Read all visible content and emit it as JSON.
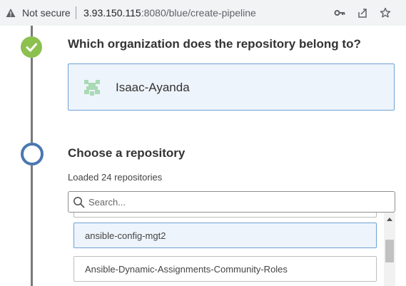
{
  "browser": {
    "security_label": "Not secure",
    "url_host": "3.93.150.115",
    "url_rest": ":8080/blue/create-pipeline"
  },
  "steps": {
    "organization": {
      "heading": "Which organization does the repository belong to?",
      "selected_org": "Isaac-Ayanda"
    },
    "repository": {
      "heading": "Choose a repository",
      "status": "Loaded 24 repositories",
      "search_placeholder": "Search...",
      "items": [
        "ansible-config-mgt2",
        "Ansible-Dynamic-Assignments-Community-Roles"
      ]
    }
  },
  "colors": {
    "check": "#8cc04f",
    "active_ring": "#4a78b0",
    "selected_border": "#6ea0d5",
    "selected_bg": "#eef4fb"
  }
}
